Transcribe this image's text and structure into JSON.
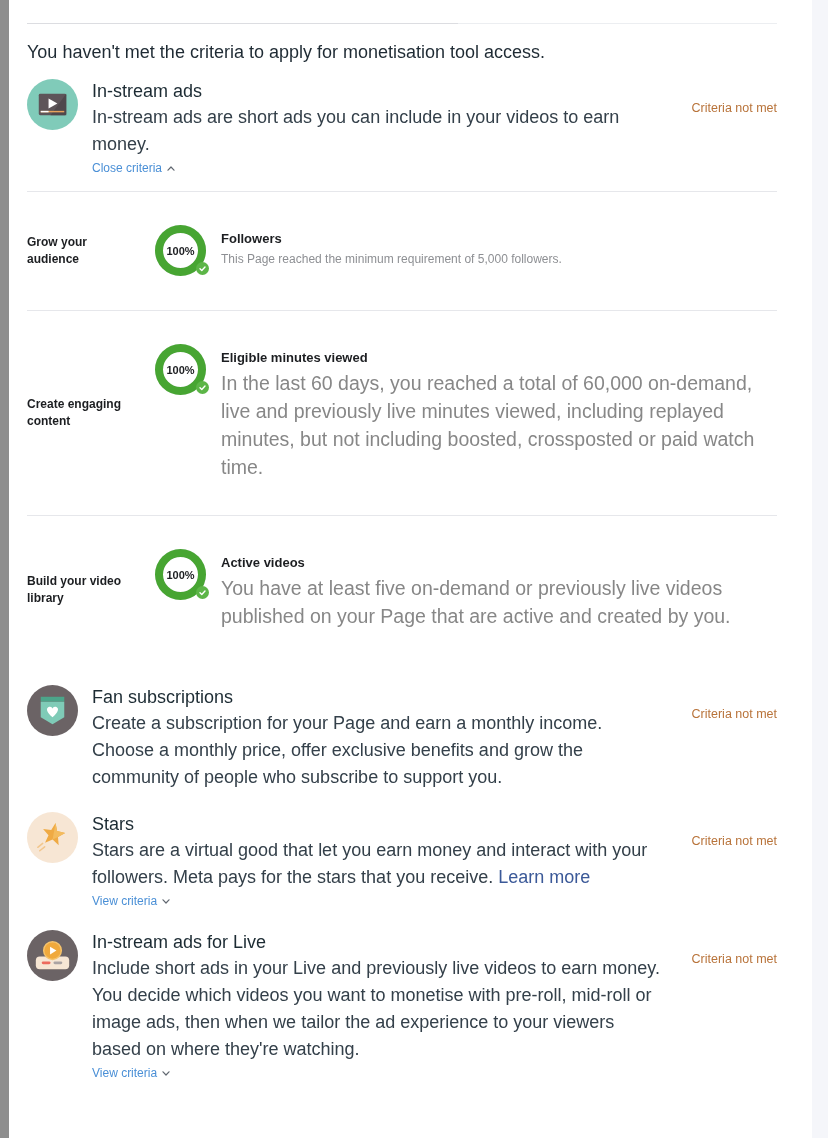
{
  "notice": "You haven't met the criteria to apply for monetisation tool access.",
  "tools": [
    {
      "title": "In-stream ads",
      "description": "In-stream ads are short ads you can include in your videos to earn money.",
      "status": "Criteria not met",
      "toggle": {
        "label": "Close criteria",
        "expanded": true
      },
      "criteria": [
        {
          "kind": "brief",
          "group": "Grow your audience",
          "name": "Followers",
          "percent": "100%",
          "level": 1,
          "met": true,
          "description": "This Page reached the minimum requirement of 5,000 followers."
        },
        {
          "kind": "full",
          "group": "Create engaging content",
          "name": "Eligible minutes viewed",
          "percent": "100%",
          "level": 1,
          "met": true,
          "description": "In the last 60 days, you reached a total of 60,000 on-demand, live and previously live minutes viewed, including replayed minutes, but not including boosted, crossposted or paid watch time."
        },
        {
          "kind": "full",
          "group": "Build your video library",
          "name": "Active videos",
          "percent": "100%",
          "level": 1,
          "met": true,
          "description": "You have at least five on-demand or previously live videos published on your Page that are active and created by you."
        }
      ]
    },
    {
      "title": "Fan subscriptions",
      "description": "Create a subscription for your Page and earn a monthly income. Choose a monthly price, offer exclusive benefits and grow the community of people who subscribe to support you.",
      "status": "Criteria not met"
    },
    {
      "title": "Stars",
      "description": "Stars are a virtual good that let you earn money and interact with your followers. Meta pays for the stars that you receive.",
      "link": "Learn more",
      "status": "Criteria not met",
      "toggle": {
        "label": "View criteria",
        "expanded": false
      }
    },
    {
      "title": "In-stream ads for Live",
      "description": "Include short ads in your Live and previously live videos to earn money. You decide which videos you want to monetise with pre-roll, mid-roll or image ads, then when we tailor the ad experience to your viewers based on where they're watching.",
      "status": "Criteria not met",
      "toggle": {
        "label": "View criteria",
        "expanded": false
      }
    }
  ]
}
